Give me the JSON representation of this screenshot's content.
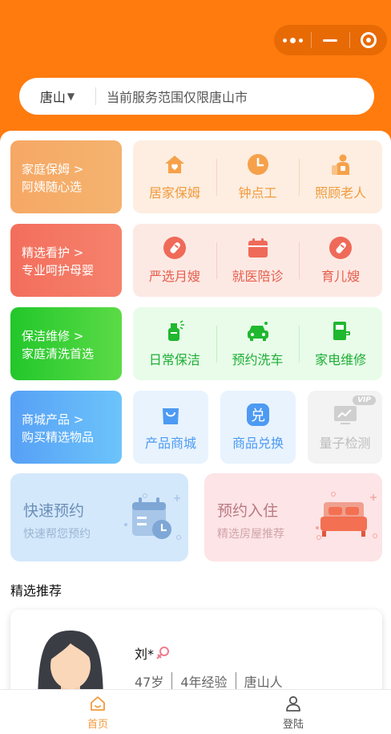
{
  "search": {
    "city": "唐山",
    "placeholder": "当前服务范围仅限唐山市"
  },
  "categories": [
    {
      "line1": "家庭保姆 >",
      "line2": "阿姨随心选",
      "items": [
        {
          "label": "居家保姆",
          "icon": "house-heart-icon"
        },
        {
          "label": "钟点工",
          "icon": "clock-icon"
        },
        {
          "label": "照顾老人",
          "icon": "elder-care-icon"
        }
      ]
    },
    {
      "line1": "精选看护 >",
      "line2": "专业呵护母婴",
      "items": [
        {
          "label": "严选月嫂",
          "icon": "baby-bottle-icon"
        },
        {
          "label": "就医陪诊",
          "icon": "calendar-icon"
        },
        {
          "label": "育儿嫂",
          "icon": "baby-bottle-icon"
        }
      ]
    },
    {
      "line1": "保洁维修 >",
      "line2": "家庭清洗首选",
      "items": [
        {
          "label": "日常保洁",
          "icon": "spray-bottle-icon"
        },
        {
          "label": "预约洗车",
          "icon": "car-wash-icon"
        },
        {
          "label": "家电维修",
          "icon": "appliance-repair-icon"
        }
      ]
    },
    {
      "line1": "商城产品 >",
      "line2": "购买精选物品",
      "items": [
        {
          "label": "产品商城",
          "icon": "shopping-bag-icon"
        },
        {
          "label": "商品兑换",
          "icon": "exchange-icon",
          "glyph": "兑"
        },
        {
          "label": "量子检测",
          "icon": "monitor-icon",
          "badge": "VIP"
        }
      ]
    }
  ],
  "promos": [
    {
      "title": "快速预约",
      "subtitle": "快速帮您预约",
      "icon": "calendar-clock-icon"
    },
    {
      "title": "预约入住",
      "subtitle": "精选房屋推荐",
      "icon": "bed-icon"
    }
  ],
  "section_title": "精选推荐",
  "profile": {
    "name": "刘*",
    "gender_icon": "female-icon",
    "age": "47岁",
    "experience": "4年经验",
    "hometown": "唐山人"
  },
  "tabs": [
    {
      "label": "首页",
      "icon": "home-icon",
      "active": true
    },
    {
      "label": "登陆",
      "icon": "user-icon",
      "active": false
    }
  ],
  "colors": {
    "brand_orange": "#ff7b0e",
    "cat1": "#f5a056",
    "cat2": "#f36f5e",
    "cat3": "#2fcd38",
    "cat4": "#5a9cf5",
    "tab_active": "#f19a3c",
    "tab_inactive": "#555555"
  }
}
